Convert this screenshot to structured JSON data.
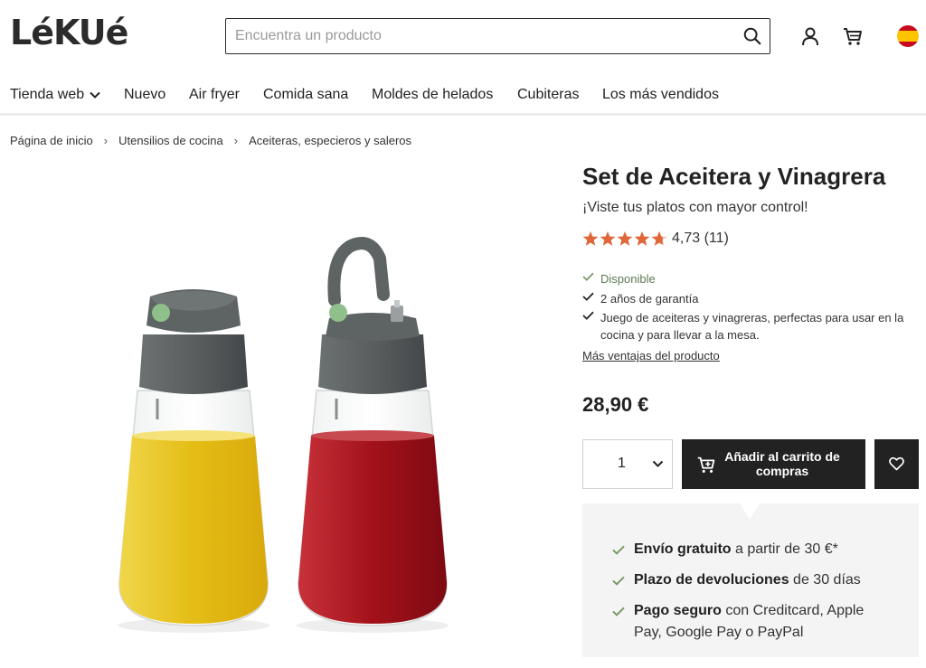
{
  "header": {
    "logo_text": "LéKUé",
    "search_placeholder": "Encuentra un producto",
    "icons": [
      "search-icon",
      "user-icon",
      "cart-icon",
      "spain-flag-icon"
    ]
  },
  "nav": {
    "items": [
      {
        "label": "Tienda web"
      },
      {
        "label": "Nuevo"
      },
      {
        "label": "Air fryer"
      },
      {
        "label": "Comida sana"
      },
      {
        "label": "Moldes de helados"
      },
      {
        "label": "Cubiteras"
      },
      {
        "label": "Los más vendidos"
      }
    ]
  },
  "breadcrumb": {
    "items": [
      "Página de inicio",
      "Utensilios de cocina",
      "Aceiteras, especieros y saleros"
    ],
    "separator": "›"
  },
  "product": {
    "title": "Set de Aceitera y Vinagrera",
    "subtitle": "¡Viste tus platos con mayor control!",
    "rating_value": "4,73",
    "rating_stars": 4.73,
    "review_count": "(11)",
    "availability": "Disponible",
    "warranty": "2 años de garantía",
    "description_line1": "Juego de aceiteras y vinagreras, perfectas para usar en la",
    "description_line2": "cocina y para llevar a la mesa.",
    "more_link": "Más ventajas del producto",
    "price": "28,90 €",
    "quantity": "1",
    "add_to_cart_line1": "Añadir al carrito de",
    "add_to_cart_line2": "compras"
  },
  "benefits": {
    "shipping_bold": "Envío gratuito",
    "shipping_rest": " a partir de 30 €*",
    "returns_bold": "Plazo de devoluciones",
    "returns_rest": " de 30 días",
    "payment_bold": "Pago seguro",
    "payment_rest_line1": " con Creditcard, Apple",
    "payment_rest_line2": "Pay, Google Pay o PayPal"
  },
  "colors": {
    "accent_dark": "#222222",
    "star": "#e0673a",
    "check_green": "#7a9a6a",
    "benefits_bg": "#f4f4f4",
    "oil": "#e8c21a",
    "vinegar": "#b3151f",
    "cap_grey": "#5a5f60",
    "button_green": "#8fbf8a"
  }
}
